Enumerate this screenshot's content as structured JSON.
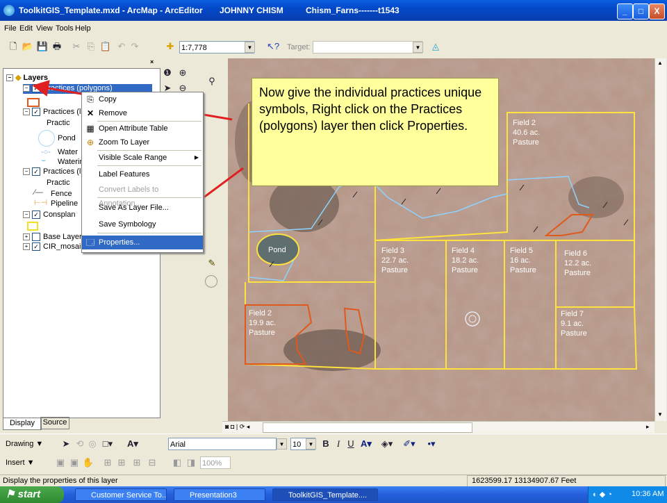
{
  "window": {
    "title": "ToolkitGIS_Template.mxd - ArcMap - ArcEditor",
    "user": "JOHNNY CHISM",
    "document": "Chism_Farns-------t1543",
    "buttons": {
      "minimize": "_",
      "maximize": "□",
      "close": "X"
    }
  },
  "menu": [
    "File",
    "Edit",
    "View",
    "Tools",
    "Help"
  ],
  "toolbar": {
    "scale_value": "1:7,778",
    "target_label": "Target:",
    "target_value": ""
  },
  "toc": {
    "root": "Layers",
    "items": [
      {
        "label": "Practices (polygons)",
        "checked": true,
        "selected": true
      },
      {
        "label": "Practices (l",
        "checked": true
      },
      {
        "label": "Practic",
        "sub": true
      },
      {
        "label": "Pond",
        "sub": true
      },
      {
        "label": "Water",
        "sub": true
      },
      {
        "label": "Waterin",
        "sub": true
      },
      {
        "label": "Practices (l",
        "checked": true
      },
      {
        "label": "Practic",
        "sub": true
      },
      {
        "label": "Fence",
        "sub": true
      },
      {
        "label": "Pipeline",
        "sub": true
      },
      {
        "label": "Consplan",
        "checked": true
      },
      {
        "label": "Base Layer",
        "checked": false
      },
      {
        "label": "CIR_mosai",
        "checked": true
      }
    ],
    "tabs": [
      "Display",
      "Source"
    ]
  },
  "context_menu": {
    "items": [
      {
        "label": "Copy",
        "icon": "copy-icon"
      },
      {
        "label": "Remove",
        "icon": "remove-icon"
      },
      {
        "label": "Open Attribute Table",
        "icon": "table-icon"
      },
      {
        "label": "Zoom To Layer",
        "icon": "zoom-layer-icon"
      },
      {
        "label": "Visible Scale Range",
        "icon": "",
        "submenu": true
      },
      {
        "label": "Label Features",
        "icon": ""
      },
      {
        "label": "Convert Labels to Annotation...",
        "icon": "",
        "disabled": true
      },
      {
        "label": "Save As Layer File...",
        "icon": ""
      },
      {
        "label": "Save Symbology",
        "icon": ""
      },
      {
        "label": "Properties...",
        "icon": "properties-icon",
        "highlighted": true
      }
    ]
  },
  "callout": {
    "text": "Now give the individual practices unique symbols, Right click on the Practices (polygons) layer then click Properties."
  },
  "map": {
    "fields": [
      {
        "name": "Field 2",
        "acres": "40.6 ac.",
        "use": "Pasture"
      },
      {
        "name": "Field 3",
        "acres": "22.7 ac.",
        "use": "Pasture"
      },
      {
        "name": "Field 4",
        "acres": "18.2 ac.",
        "use": "Pasture"
      },
      {
        "name": "Field 5",
        "acres": "16 ac.",
        "use": "Pasture"
      },
      {
        "name": "Field 6",
        "acres": "12.2 ac.",
        "use": "Pasture"
      },
      {
        "name": "Field 7",
        "acres": "9.1 ac.",
        "use": "Pasture"
      },
      {
        "name": "Field 2",
        "acres": "19.9 ac.",
        "use": "Pasture"
      }
    ],
    "pond_label": "Pond"
  },
  "draw_toolbar": {
    "drawing_label": "Drawing",
    "font": "Arial",
    "font_size": "10",
    "insert_label": "Insert",
    "zoom_pct": "100%"
  },
  "status": {
    "message": "Display the properties of this layer",
    "coords": "1623599.17  13134907.67 Feet"
  },
  "taskbar": {
    "start": "start",
    "tasks": [
      "Customer Service To...",
      "Presentation3",
      "ToolkitGIS_Template...."
    ],
    "clock": "10:36 AM"
  },
  "colors": {
    "field_boundary": "#ffe23b",
    "practice_polygon": "#e0581a",
    "water_line": "#8fd3ff",
    "arrow": "#e02020",
    "callout_bg": "#ffff9c",
    "selection": "#316ac5"
  }
}
